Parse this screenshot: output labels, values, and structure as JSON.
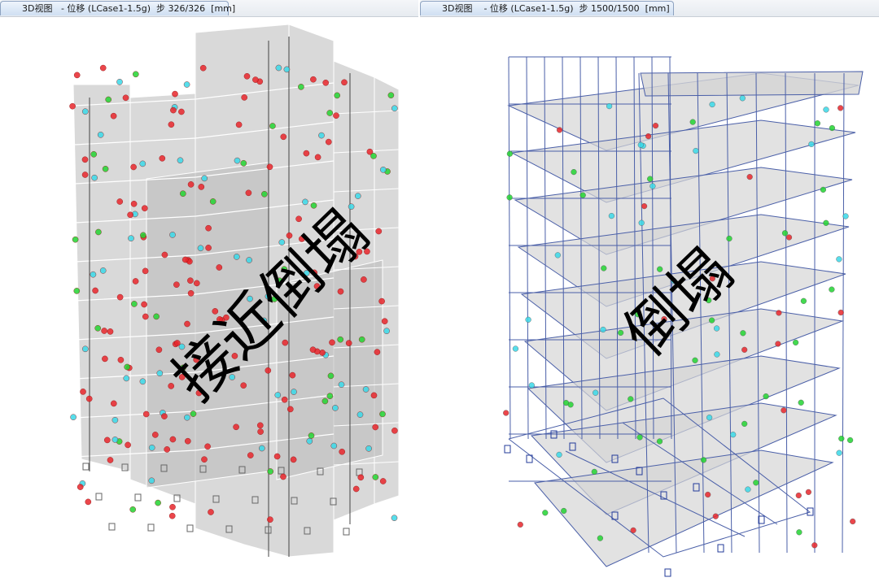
{
  "tabs": {
    "left": "3D视图   - 位移 (LCase1-1.5g)  步 326/326  [mm]",
    "right": "3D视图    - 位移 (LCase1-1.5g)  步 1500/1500  [mm]"
  },
  "overlays": {
    "left": "接近倒塌",
    "right": "倒塌"
  },
  "colors": {
    "hinge_red": "#e8262b",
    "hinge_green": "#22d431",
    "hinge_cyan": "#3ad8e8",
    "frame_blue": "#4a5fa8",
    "wall_gray": "#b9b9b9",
    "slab_gray": "#d5d5d5"
  }
}
